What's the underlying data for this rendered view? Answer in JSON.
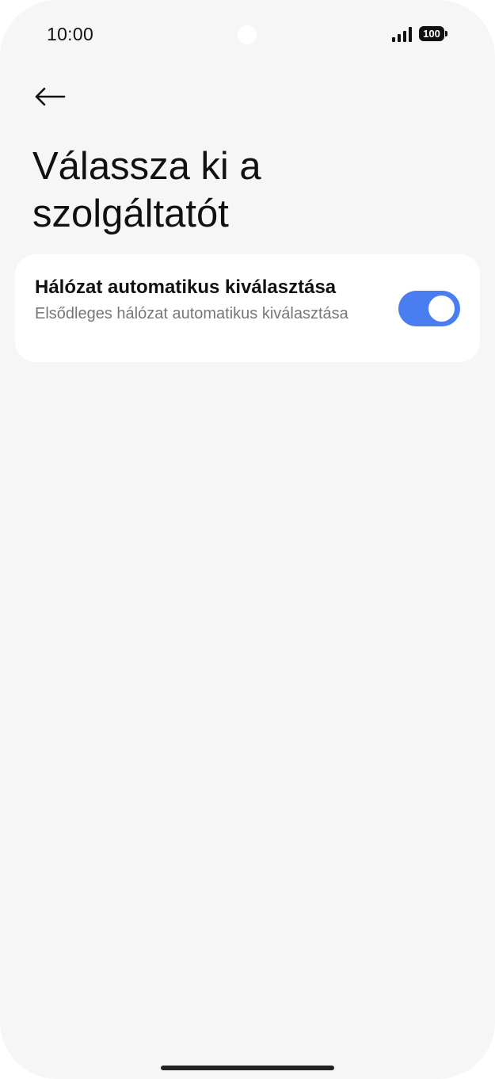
{
  "status_bar": {
    "time": "10:00",
    "battery_level": "100",
    "signal_icon": "signal-bars-icon",
    "battery_icon": "battery-icon"
  },
  "header": {
    "back_icon": "arrow-left-icon",
    "title": "Válassza ki a szolgáltatót"
  },
  "settings": {
    "auto_select": {
      "title": "Hálózat automatikus kiválasztása",
      "subtitle": "Elsődleges hálózat automatikus kiválasztása",
      "enabled": true
    }
  },
  "colors": {
    "accent": "#4a7ef0",
    "background": "#f6f6f6",
    "card": "#ffffff",
    "text_primary": "#111111",
    "text_secondary": "#777777"
  }
}
